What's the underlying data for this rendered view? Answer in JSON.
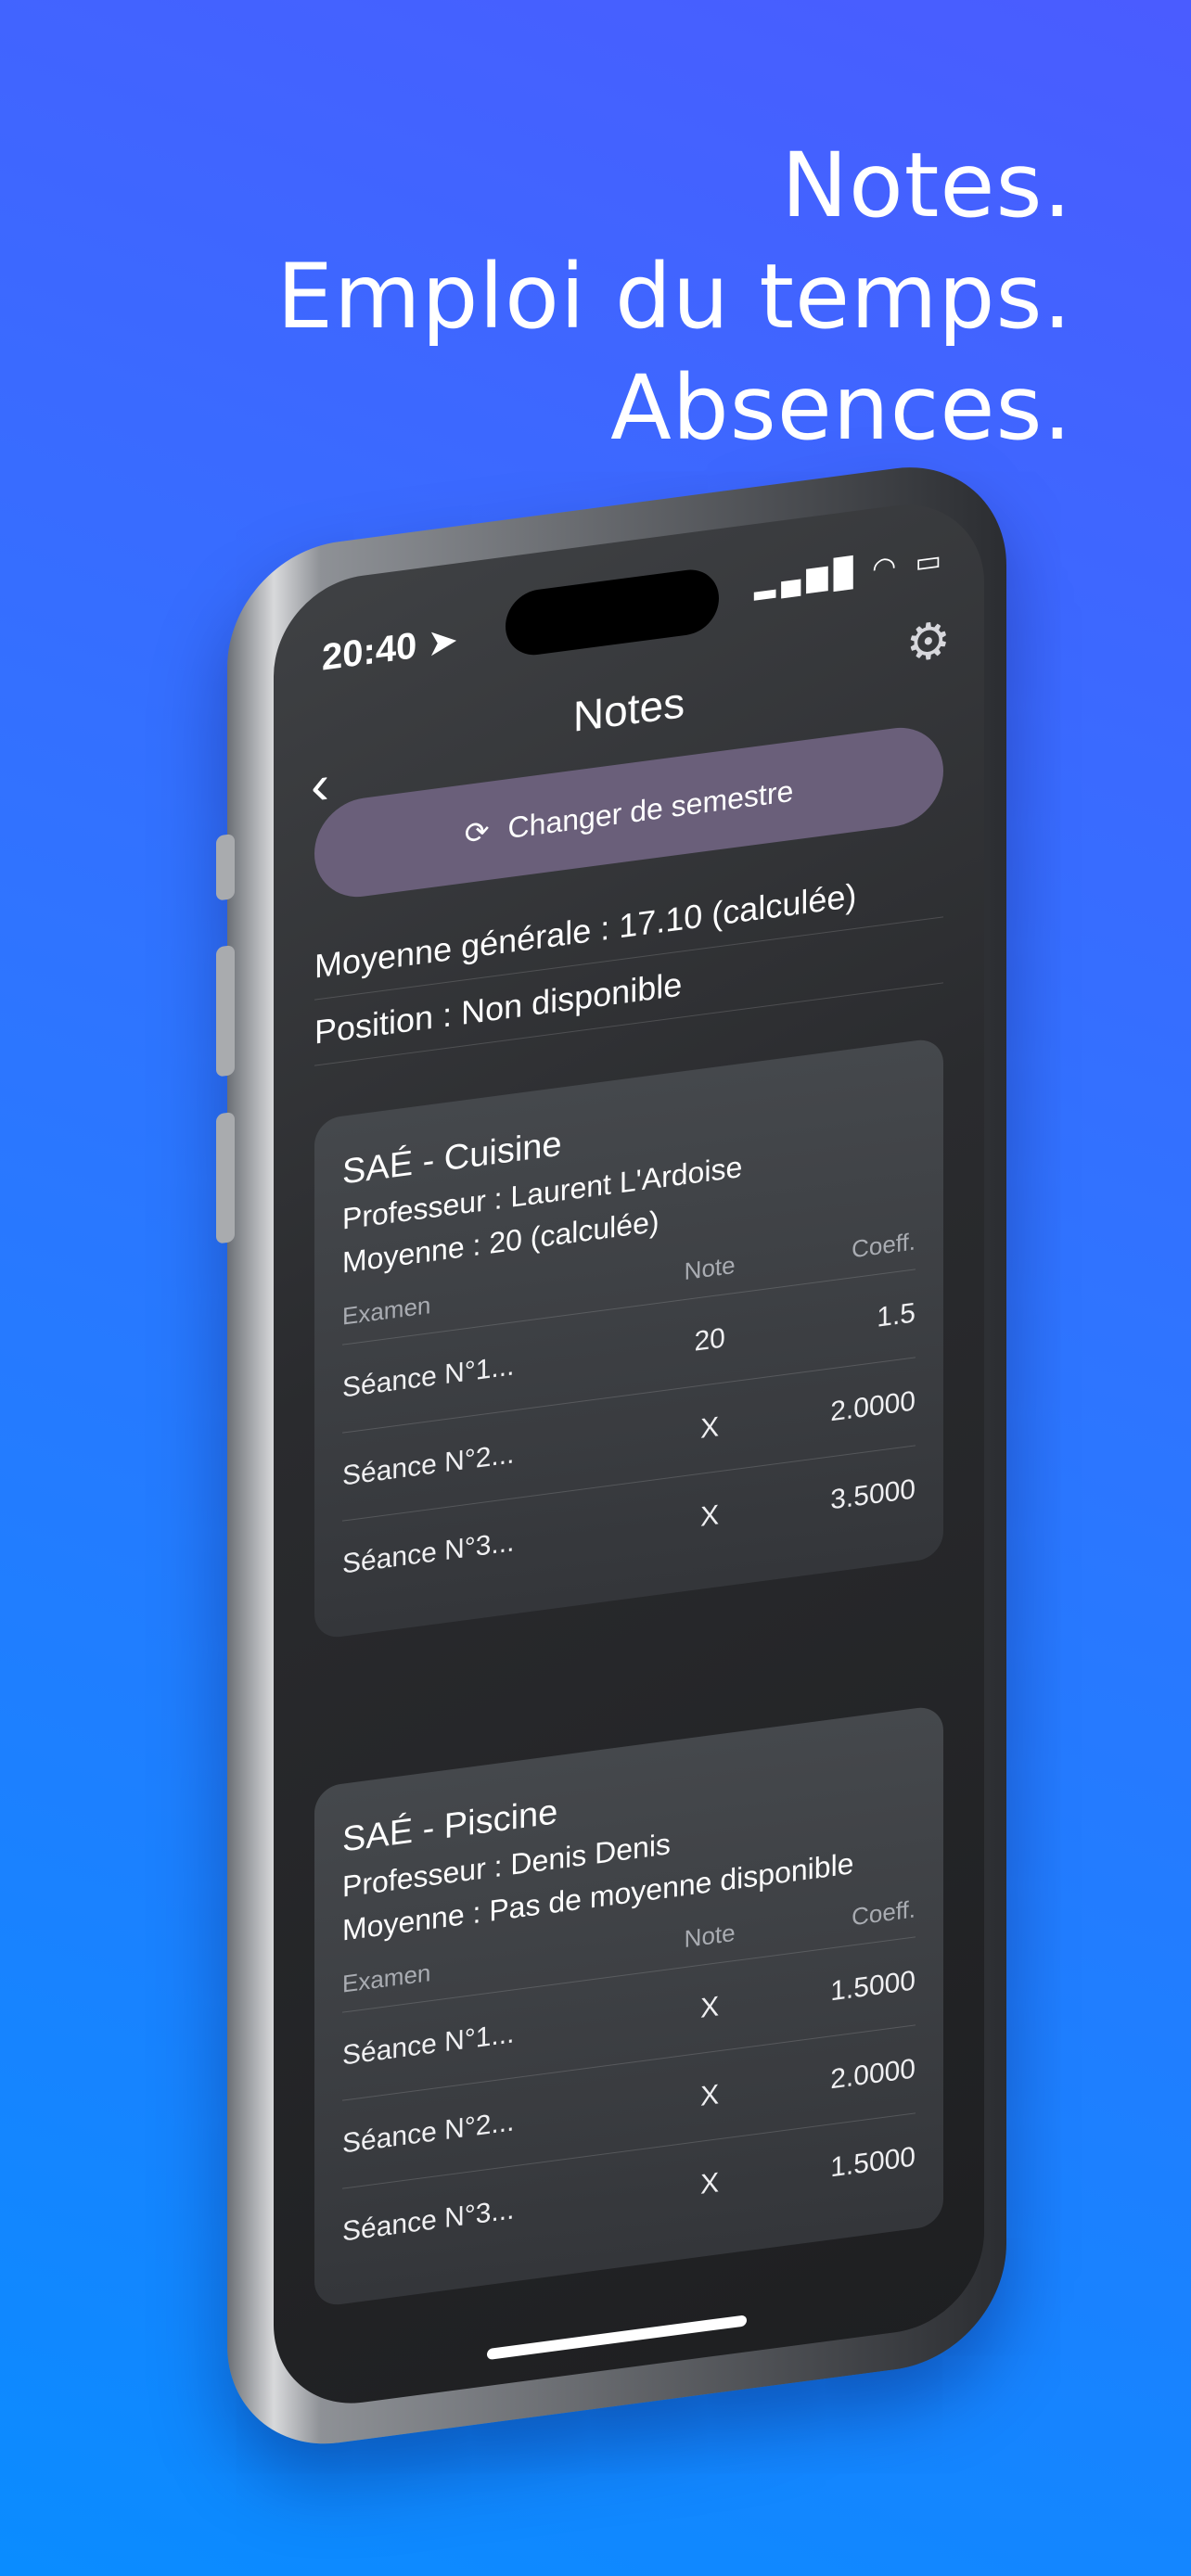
{
  "headline": [
    "Notes.",
    "Emploi du temps.",
    "Absences."
  ],
  "status": {
    "time": "20:40",
    "location_icon": "location-arrow-icon"
  },
  "nav": {
    "title": "Notes",
    "back_icon": "chevron-left-icon",
    "settings_icon": "gear-icon"
  },
  "semester_button": {
    "label": "Changer de semestre",
    "icon": "refresh-icon"
  },
  "summary": {
    "average": "Moyenne générale : 17.10 (calculée)",
    "position": "Position : Non disponible"
  },
  "columns": {
    "exam": "Examen",
    "note": "Note",
    "coeff": "Coeff."
  },
  "cards": [
    {
      "title": "SAÉ - Cuisine",
      "teacher": "Professeur : Laurent L'Ardoise",
      "average": "Moyenne : 20 (calculée)",
      "rows": [
        {
          "exam": "Séance N°1...",
          "note": "20",
          "coeff": "1.5"
        },
        {
          "exam": "Séance N°2...",
          "note": "X",
          "coeff": "2.0000"
        },
        {
          "exam": "Séance N°3...",
          "note": "X",
          "coeff": "3.5000"
        }
      ]
    },
    {
      "title": "SAÉ - Piscine",
      "teacher": "Professeur : Denis Denis",
      "average": "Moyenne : Pas de moyenne disponible",
      "rows": [
        {
          "exam": "Séance N°1...",
          "note": "X",
          "coeff": "1.5000"
        },
        {
          "exam": "Séance N°2...",
          "note": "X",
          "coeff": "2.0000"
        },
        {
          "exam": "Séance N°3...",
          "note": "X",
          "coeff": "1.5000"
        }
      ]
    }
  ]
}
